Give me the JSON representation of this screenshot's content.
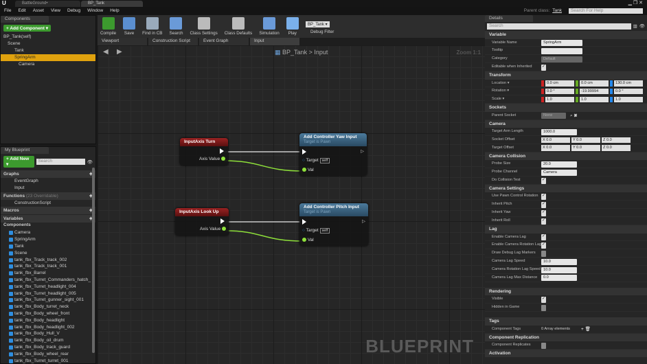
{
  "window": {
    "tabs": [
      "BattleGround•",
      "BP_Tank"
    ],
    "parent_class_label": "Parent class:",
    "parent_class": "Tank",
    "help_search_placeholder": "Search For Help"
  },
  "menu": [
    "File",
    "Edit",
    "Asset",
    "View",
    "Debug",
    "Window",
    "Help"
  ],
  "components": {
    "tab": "Components",
    "add_button": "+ Add Component ▾",
    "self": "BP_Tank(self)",
    "tree": [
      "Scene",
      "Tank",
      "SpringArm",
      "Camera"
    ]
  },
  "my_blueprint": {
    "tab": "My Blueprint",
    "add_button": "+ Add New ▾",
    "search_placeholder": "Search",
    "graphs_label": "Graphs",
    "graphs": [
      "EventGraph",
      "Input"
    ],
    "functions_label": "Functions",
    "functions_note": "(23 Overridable)",
    "functions": [
      "ConstructionScript"
    ],
    "macros_label": "Macros",
    "variables_label": "Variables",
    "components_label": "Components",
    "components": [
      "Camera",
      "SpringArm",
      "Tank",
      "Scene",
      "tank_fbx_Track_track_002",
      "tank_fbx_Track_track_001",
      "tank_fbx_Barrel",
      "tank_fbx_Turret_Commanders_hatch_",
      "tank_fbx_Turret_headlight_004",
      "tank_fbx_Turret_headlight_005",
      "tank_fbx_Turret_gunner_sight_001",
      "tank_fbx_Body_turret_neck",
      "tank_fbx_Body_wheel_front",
      "tank_fbx_Body_headlight",
      "tank_fbx_Body_headlight_002",
      "tank_fbx_Body_Hull_V",
      "tank_fbx_Body_oil_drum",
      "tank_fbx_Body_track_guard",
      "tank_fbx_Body_wheel_rear",
      "tank_fbx_Turret_turret_001"
    ]
  },
  "toolbar": {
    "items": [
      "Compile",
      "Save",
      "Find in CB",
      "Search",
      "Class Settings",
      "Class Defaults",
      "Simulation",
      "Play"
    ],
    "debug_value": "BP_Tank ▾",
    "debug_label": "Debug Filter"
  },
  "graph_tabs": [
    "Viewport",
    "Construction Script",
    "Event Graph",
    "Input"
  ],
  "graph": {
    "breadcrumb_bp": "BP_Tank",
    "breadcrumb_sep": ">",
    "breadcrumb_graph": "Input",
    "zoom": "Zoom 1:1",
    "watermark": "BLUEPRINT",
    "nodes": [
      {
        "title": "InputAxis Turn",
        "pin": "Axis Value"
      },
      {
        "title": "Add Controller Yaw Input",
        "subtitle": "Target is Pawn",
        "target": "Target",
        "self": "self",
        "val": "Val"
      },
      {
        "title": "InputAxis Look Up",
        "pin": "Axis Value"
      },
      {
        "title": "Add Controller Pitch Input",
        "subtitle": "Target is Pawn",
        "target": "Target",
        "self": "self",
        "val": "Val"
      }
    ]
  },
  "details": {
    "tab": "Details",
    "search_placeholder": "Search",
    "variable": {
      "label": "Variable",
      "name_label": "Variable Name",
      "name": "SpringArm",
      "tooltip_label": "Tooltip",
      "category_label": "Category",
      "category": "Default",
      "editable_label": "Editable when Inherited"
    },
    "transform": {
      "label": "Transform",
      "location_label": "Location ▾",
      "location": [
        "0.0 cm",
        "0.0 cm",
        "130.0 cm"
      ],
      "rotation_label": "Rotation ▾",
      "rotation": [
        "0.0 °",
        "-19.99994",
        "0.0 °"
      ],
      "scale_label": "Scale ▾",
      "scale": [
        "1.0",
        "1.0",
        "1.0"
      ]
    },
    "sockets": {
      "label": "Sockets",
      "parent_label": "Parent Socket",
      "parent": "None"
    },
    "camera": {
      "label": "Camera",
      "arm_label": "Target Arm Length",
      "arm": "1000.0",
      "socket_label": "Socket Offset",
      "socket": [
        "X 0.0",
        "Y 0.0",
        "Z 0.0"
      ],
      "target_label": "Target Offset",
      "target": [
        "X 0.0",
        "Y 0.0",
        "Z 0.0"
      ]
    },
    "collision": {
      "label": "Camera Collision",
      "probe_size_label": "Probe Size",
      "probe_size": "20.0",
      "probe_channel_label": "Probe Channel",
      "probe_channel": "Camera",
      "test_label": "Do Collision Test"
    },
    "settings": {
      "label": "Camera Settings",
      "rows": [
        "Use Pawn Control Rotation",
        "Inherit Pitch",
        "Inherit Yaw",
        "Inherit Roll"
      ]
    },
    "lag": {
      "label": "Lag",
      "enable": "Enable Camera Lag",
      "enable_rot": "Enable Camera Rotation Lag",
      "debug": "Draw Debug Lag Markers",
      "speed_label": "Camera Lag Speed",
      "speed": "10.0",
      "rot_speed_label": "Camera Rotation Lag Speed",
      "rot_speed": "10.0",
      "max_label": "Camera Lag Max Distance",
      "max": "0.0"
    },
    "rendering": {
      "label": "Rendering",
      "visible": "Visible",
      "hidden": "Hidden in Game"
    },
    "tags": {
      "label": "Tags",
      "row": "Component Tags",
      "value": "0 Array elements"
    },
    "replication": {
      "label": "Component Replication",
      "row": "Component Replicates"
    },
    "activation": {
      "label": "Activation"
    }
  },
  "colors": {
    "accent": "#e0a20e",
    "green": "#3c9a2e",
    "node_red": "#9a2222",
    "node_blue": "#4b7a9c",
    "wire": "#8ee03a"
  }
}
